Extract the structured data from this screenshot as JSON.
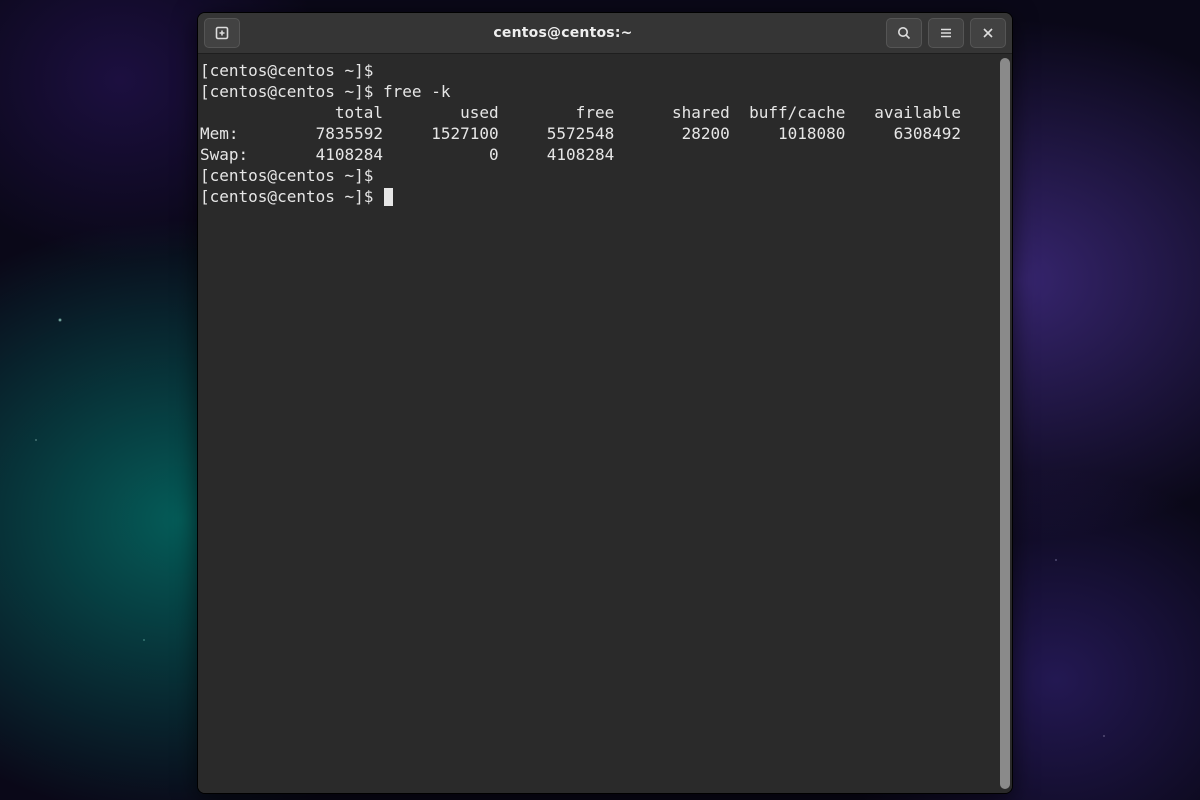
{
  "window": {
    "title": "centos@centos:~"
  },
  "prompt": "[centos@centos ~]$ ",
  "command": "free -k",
  "output": {
    "header": "              total        used        free      shared  buff/cache   available",
    "mem": "Mem:        7835592     1527100     5572548       28200     1018080     6308492",
    "swap": "Swap:       4108284           0     4108284"
  }
}
